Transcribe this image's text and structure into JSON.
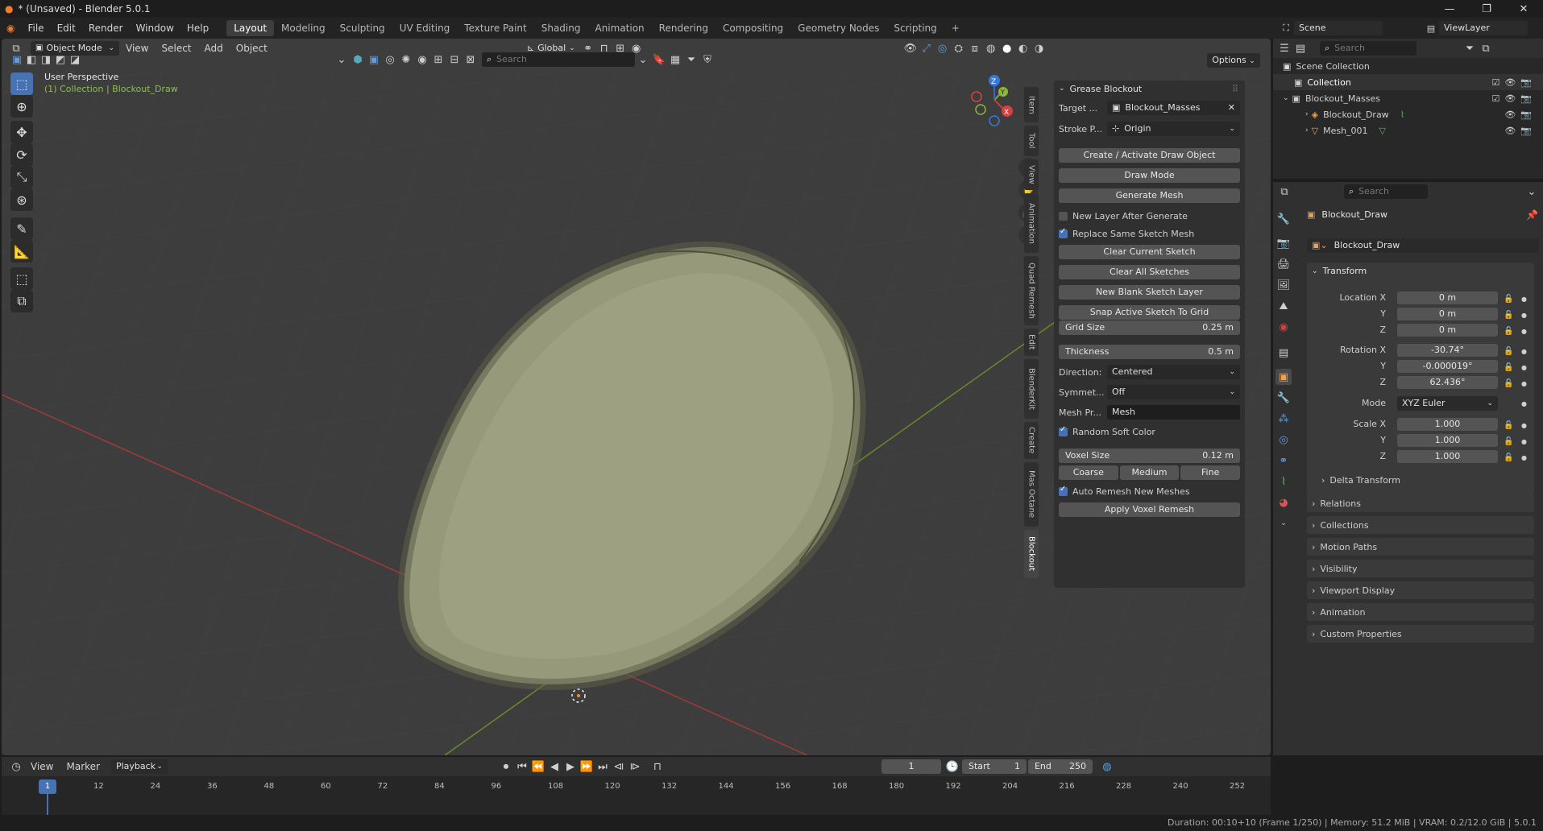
{
  "window": {
    "title": "* (Unsaved) - Blender 5.0.1"
  },
  "menu": [
    "File",
    "Edit",
    "Render",
    "Window",
    "Help"
  ],
  "workspaces": [
    "Layout",
    "Modeling",
    "Sculpting",
    "UV Editing",
    "Texture Paint",
    "Shading",
    "Animation",
    "Rendering",
    "Compositing",
    "Geometry Nodes",
    "Scripting"
  ],
  "scene": {
    "label": "Scene",
    "view_layer": "ViewLayer"
  },
  "viewport_header": {
    "mode": "Object Mode",
    "menus": [
      "View",
      "Select",
      "Add",
      "Object"
    ],
    "orientation": "Global",
    "search_placeholder": "Search",
    "options": "Options"
  },
  "viewport": {
    "perspective": "User Perspective",
    "collection_info": "(1) Collection | Blockout_Draw"
  },
  "side_tabs": [
    "Item",
    "Tool",
    "View",
    "Animation",
    "Quad Remesh",
    "Edit",
    "BlenderKit",
    "Create",
    "Mas Octane",
    "Blockout"
  ],
  "blockout": {
    "title": "Grease Blockout",
    "target_label": "Target ...",
    "target_value": "Blockout_Masses",
    "stroke_label": "Stroke P...",
    "stroke_value": "Origin",
    "btn_create": "Create / Activate Draw Object",
    "btn_draw": "Draw Mode",
    "btn_generate": "Generate Mesh",
    "chk_new_layer": "New Layer After Generate",
    "chk_replace": "Replace Same Sketch Mesh",
    "btn_clear_current": "Clear Current Sketch",
    "btn_clear_all": "Clear All Sketches",
    "btn_new_layer": "New Blank Sketch Layer",
    "btn_snap": "Snap Active Sketch To Grid",
    "grid_label": "Grid Size",
    "grid_value": "0.25 m",
    "thickness_label": "Thickness",
    "thickness_value": "0.5 m",
    "direction_label": "Direction:",
    "direction_value": "Centered",
    "symmetry_label": "Symmet...",
    "symmetry_value": "Off",
    "mesh_label": "Mesh Pr...",
    "mesh_value": "Mesh",
    "chk_random": "Random Soft Color",
    "voxel_label": "Voxel Size",
    "voxel_value": "0.12 m",
    "coarse": "Coarse",
    "medium": "Medium",
    "fine": "Fine",
    "chk_auto": "Auto Remesh New Meshes",
    "btn_apply": "Apply Voxel Remesh"
  },
  "outliner": {
    "search_placeholder": "Search",
    "items": [
      {
        "label": "Scene Collection"
      },
      {
        "label": "Collection"
      },
      {
        "label": "Blockout_Masses"
      },
      {
        "label": "Blockout_Draw"
      },
      {
        "label": "Mesh_001"
      }
    ]
  },
  "properties": {
    "search_placeholder": "Search",
    "object_name": "Blockout_Draw",
    "object_field": "Blockout_Draw",
    "transform": "Transform",
    "location_label": "Location X",
    "y": "Y",
    "z": "Z",
    "loc": [
      "0 m",
      "0 m",
      "0 m"
    ],
    "rotation_label": "Rotation X",
    "rot": [
      "-30.74°",
      "-0.000019°",
      "62.436°"
    ],
    "mode_label": "Mode",
    "mode_value": "XYZ Euler",
    "scale_label": "Scale X",
    "scale": [
      "1.000",
      "1.000",
      "1.000"
    ],
    "delta": "Delta Transform",
    "sections": [
      "Relations",
      "Collections",
      "Motion Paths",
      "Visibility",
      "Viewport Display",
      "Animation",
      "Custom Properties"
    ]
  },
  "timeline": {
    "menus": [
      "View",
      "Marker",
      "Playback"
    ],
    "current_frame": "1",
    "start_label": "Start",
    "start": "1",
    "end_label": "End",
    "end": "250",
    "ticks": [
      "12",
      "24",
      "36",
      "48",
      "60",
      "72",
      "84",
      "96",
      "108",
      "120",
      "132",
      "144",
      "156",
      "168",
      "180",
      "192",
      "204",
      "216",
      "228",
      "240",
      "252"
    ],
    "cursor": "1"
  },
  "status": {
    "text": "Duration: 00:10+10 (Frame 1/250) | Memory: 51.2 MiB | VRAM: 0.2/12.0 GiB | 5.0.1"
  }
}
